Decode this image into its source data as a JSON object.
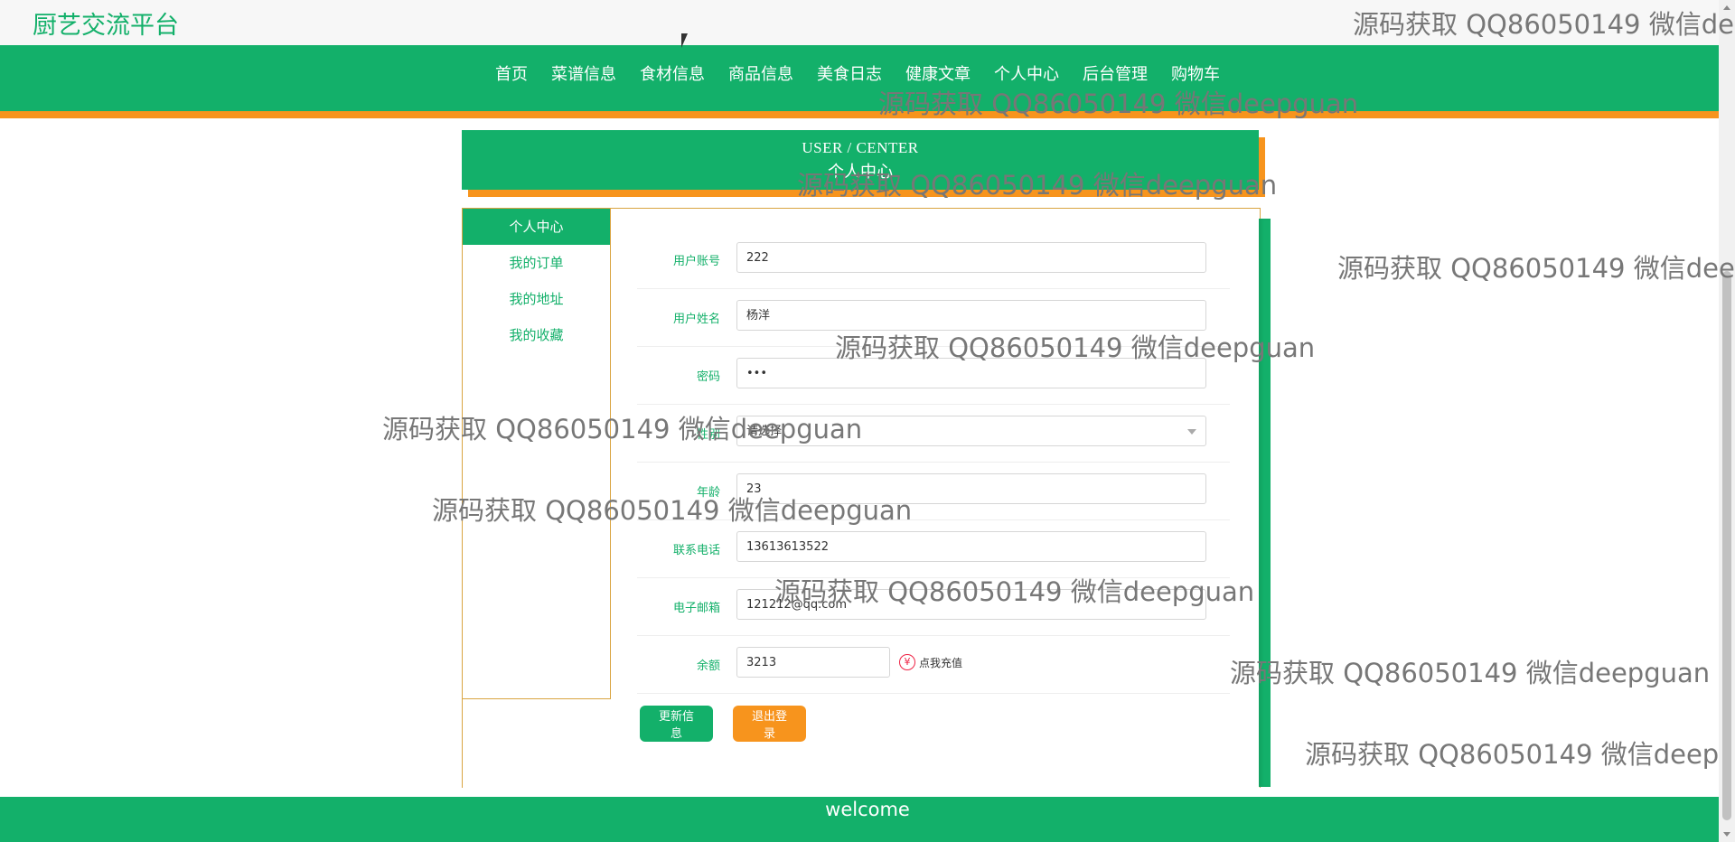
{
  "header": {
    "site_title": "厨艺交流平台"
  },
  "nav": {
    "items": [
      "首页",
      "菜谱信息",
      "食材信息",
      "商品信息",
      "美食日志",
      "健康文章",
      "个人中心",
      "后台管理",
      "购物车"
    ]
  },
  "page_head": {
    "en": "USER / CENTER",
    "cn": "个人中心"
  },
  "sidebar": {
    "items": [
      "个人中心",
      "我的订单",
      "我的地址",
      "我的收藏"
    ]
  },
  "form": {
    "account": {
      "label": "用户账号",
      "value": "222"
    },
    "name": {
      "label": "用户姓名",
      "value": "杨洋"
    },
    "password": {
      "label": "密码",
      "value": "•••"
    },
    "gender": {
      "label": "性别",
      "value": "请选择"
    },
    "age": {
      "label": "年龄",
      "value": "23"
    },
    "phone": {
      "label": "联系电话",
      "value": "13613613522"
    },
    "email": {
      "label": "电子邮箱",
      "value": "121212@qq.com"
    },
    "balance": {
      "label": "余额",
      "value": "3213",
      "recharge": "点我充值",
      "yen": "¥"
    }
  },
  "buttons": {
    "update": "更新信息",
    "logout": "退出登录"
  },
  "footer": {
    "text": "welcome"
  },
  "watermark": {
    "text": "源码获取 QQ86050149 微信deepguan",
    "text_cut_1": "源码获取 QQ86050149 微信de",
    "text_cut_2": "源码获取 QQ86050149 微信dee",
    "text_cut_3": "源码获取 QQ86050149 微信deep"
  },
  "colors": {
    "primary": "#13b06a",
    "accent": "#f7941d"
  }
}
